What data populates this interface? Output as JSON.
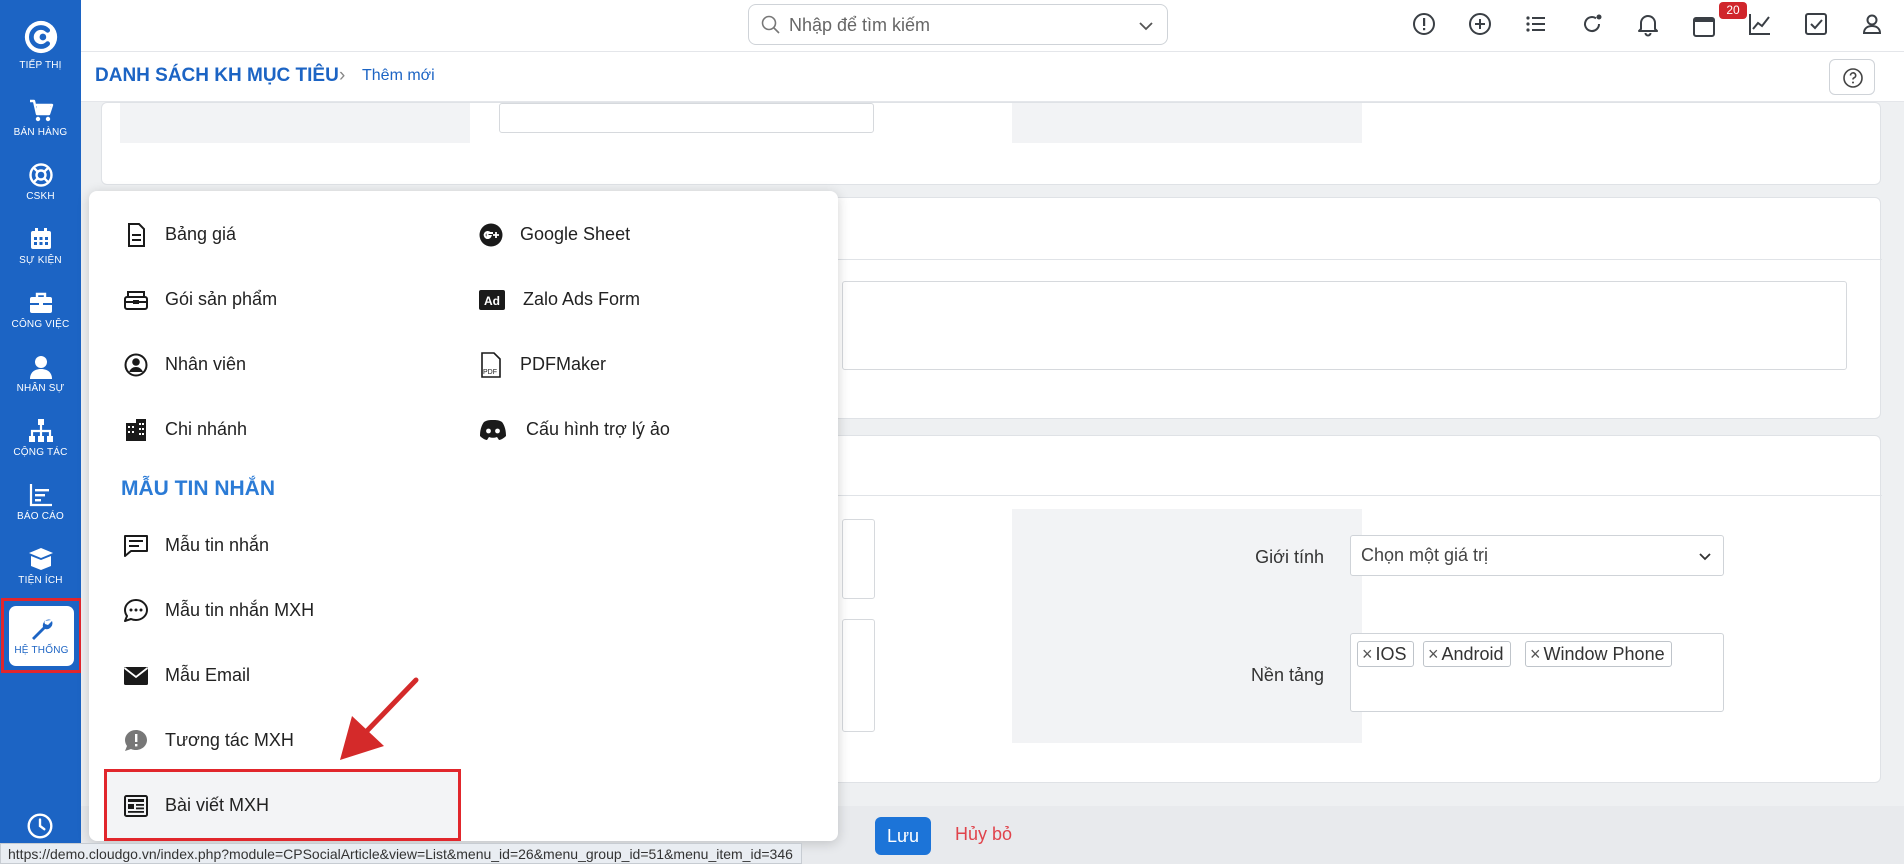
{
  "sidebar": {
    "items": [
      {
        "label": "TIẾP THỊ",
        "icon": "logo-icon"
      },
      {
        "label": "BÁN HÀNG",
        "icon": "cart-icon"
      },
      {
        "label": "CSKH",
        "icon": "lifebuoy-icon"
      },
      {
        "label": "SỰ KIỆN",
        "icon": "calendar-icon"
      },
      {
        "label": "CÔNG VIỆC",
        "icon": "briefcase-icon"
      },
      {
        "label": "NHÂN SỰ",
        "icon": "person-icon"
      },
      {
        "label": "CỘNG TÁC",
        "icon": "org-chart-icon"
      },
      {
        "label": "BÁO CÁO",
        "icon": "report-icon"
      },
      {
        "label": "TIỆN ÍCH",
        "icon": "box-icon"
      },
      {
        "label": "HỆ THỐNG",
        "icon": "wrench-icon"
      }
    ]
  },
  "topbar": {
    "search_placeholder": "Nhập để tìm kiếm",
    "notification_count": "20",
    "icons": [
      "alert-icon",
      "add-icon",
      "list-icon",
      "refresh-icon",
      "bell-icon",
      "calendar-icon",
      "chart-icon",
      "checkbox-icon",
      "user-icon"
    ]
  },
  "breadcrumb": {
    "main": "DANH SÁCH KH MỤC TIÊU",
    "separator": "›",
    "current": "Thêm mới"
  },
  "form": {
    "gender_label": "Giới tính",
    "gender_value": "Chọn một giá trị",
    "platform_label": "Nền tảng",
    "platform_tags": [
      "IOS",
      "Android",
      "Window Phone"
    ],
    "tag_remove_glyph": "×"
  },
  "menu": {
    "left_items": [
      {
        "label": "Bảng giá",
        "icon": "document-icon"
      },
      {
        "label": "Gói sản phẩm",
        "icon": "package-icon"
      },
      {
        "label": "Nhân viên",
        "icon": "user-circle-icon"
      },
      {
        "label": "Chi nhánh",
        "icon": "building-icon"
      }
    ],
    "right_items": [
      {
        "label": "Google Sheet",
        "icon": "google-icon"
      },
      {
        "label": "Zalo Ads Form",
        "icon": "ad-icon"
      },
      {
        "label": "PDFMaker",
        "icon": "pdf-icon"
      },
      {
        "label": "Cấu hình trợ lý ảo",
        "icon": "discord-icon"
      }
    ],
    "section_title": "MẪU TIN NHẮN",
    "section_items": [
      {
        "label": "Mẫu tin nhắn",
        "icon": "message-icon"
      },
      {
        "label": "Mẫu tin nhắn MXH",
        "icon": "chat-bubble-icon"
      },
      {
        "label": "Mẫu Email",
        "icon": "envelope-icon"
      },
      {
        "label": "Tương tác MXH",
        "icon": "exclaim-bubble-icon"
      },
      {
        "label": "Bài viết MXH",
        "icon": "newspaper-icon"
      }
    ],
    "pdf_icon_text": "PDF",
    "ad_icon_text": "Ad"
  },
  "actions": {
    "save": "Lưu",
    "cancel": "Hủy bỏ"
  },
  "status_url": "https://demo.cloudgo.vn/index.php?module=CPSocialArticle&view=List&menu_id=26&menu_group_id=51&menu_item_id=346",
  "colors": {
    "sidebar": "#1c64c4",
    "accent": "#1c74d8",
    "highlight_red": "#e1262c",
    "section_title": "#2b7bd6",
    "cancel": "#e0434b"
  }
}
